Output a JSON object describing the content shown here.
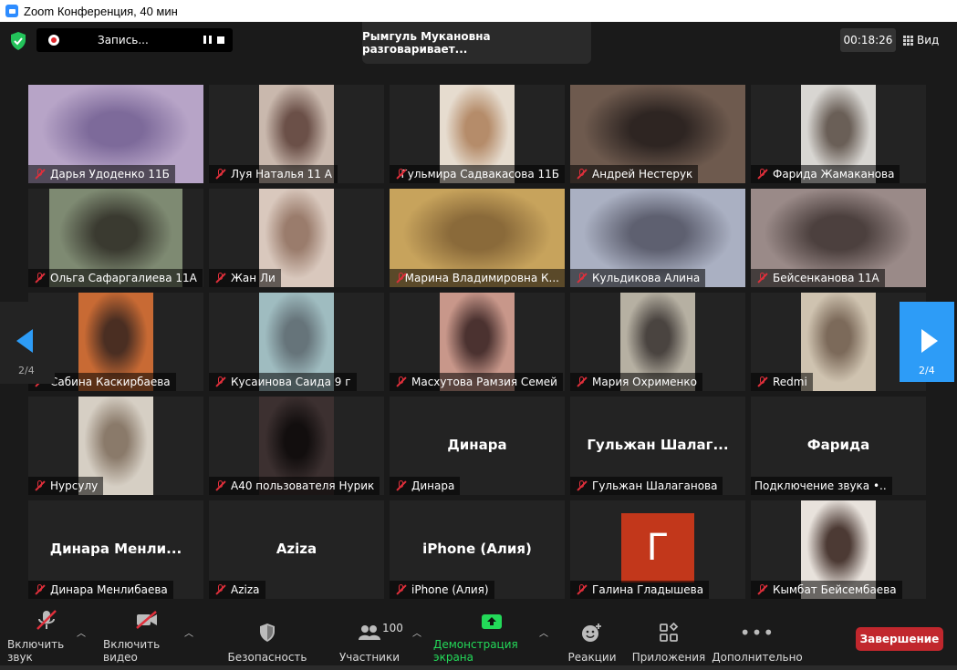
{
  "window": {
    "title": "Zoom Конференция, 40 мин"
  },
  "recording": {
    "label": "Запись..."
  },
  "speaker_banner": "Рымгуль Мукановна разговаривает...",
  "timer": "00:18:26",
  "view_label": "Вид",
  "pagination": {
    "left": "2/4",
    "right": "2/4"
  },
  "participants": [
    {
      "name": "Дарья Удоденко 11Б",
      "muted": true,
      "video": true,
      "vidx": 0,
      "vw": 192,
      "c1": "#b7a4c7",
      "c2": "#7d6a9a"
    },
    {
      "name": "Луя Наталья 11 А",
      "muted": true,
      "video": true,
      "vidx": 55,
      "vw": 82,
      "c1": "#c9b8ad",
      "c2": "#6b5048"
    },
    {
      "name": "Гульмира Садвакасова 11Б",
      "muted": true,
      "video": true,
      "vidx": 55,
      "vw": 82,
      "c1": "#e6dccf",
      "c2": "#b58c6a"
    },
    {
      "name": "Андрей Нестерук",
      "muted": true,
      "video": true,
      "vidx": 0,
      "vw": 192,
      "c1": "#6e5a4e",
      "c2": "#2e2522"
    },
    {
      "name": "Фарида Жамаканова",
      "muted": true,
      "video": true,
      "vidx": 55,
      "vw": 82,
      "c1": "#d8d6d2",
      "c2": "#6a5f57"
    },
    {
      "name": "Ольга Сафаргалиева 11А",
      "muted": true,
      "video": true,
      "vidx": 23,
      "vw": 146,
      "c1": "#7e8a72",
      "c2": "#3a3a30"
    },
    {
      "name": "Жан Ли",
      "muted": true,
      "video": true,
      "vidx": 55,
      "vw": 82,
      "c1": "#d9c8bd",
      "c2": "#9a7c6c"
    },
    {
      "name": "Марина Владимировна К...",
      "muted": true,
      "video": true,
      "vidx": 0,
      "vw": 192,
      "c1": "#c7a35c",
      "c2": "#8a6a3a"
    },
    {
      "name": "Кульдикова Алина",
      "muted": true,
      "video": true,
      "vidx": 0,
      "vw": 192,
      "c1": "#aab0c2",
      "c2": "#5e6070"
    },
    {
      "name": "Бейсенканова 11А",
      "muted": true,
      "video": true,
      "vidx": 0,
      "vw": 192,
      "c1": "#9a8a88",
      "c2": "#4c403e"
    },
    {
      "name": "Сабина Каскирбаева",
      "muted": true,
      "video": true,
      "vidx": 55,
      "vw": 82,
      "c1": "#c86a34",
      "c2": "#4a2e22"
    },
    {
      "name": "Кусаинова Саида 9 г",
      "muted": true,
      "video": true,
      "vidx": 55,
      "vw": 82,
      "c1": "#9fbcc0",
      "c2": "#66747a"
    },
    {
      "name": "Масхутова Рамзия Семей",
      "muted": true,
      "video": true,
      "vidx": 55,
      "vw": 82,
      "c1": "#c8978a",
      "c2": "#4b3230"
    },
    {
      "name": "Мария Охрименко",
      "muted": true,
      "video": true,
      "vidx": 55,
      "vw": 82,
      "c1": "#b6b0a2",
      "c2": "#4a4440"
    },
    {
      "name": "Redmi",
      "muted": true,
      "video": true,
      "vidx": 55,
      "vw": 82,
      "c1": "#cfc3b0",
      "c2": "#7c6a5a"
    },
    {
      "name": "Нурсулу",
      "muted": true,
      "video": true,
      "vidx": 55,
      "vw": 82,
      "c1": "#d6cfc4",
      "c2": "#8a7a6a"
    },
    {
      "name": "А40 пользователя Нурик",
      "muted": true,
      "video": true,
      "vidx": 55,
      "vw": 82,
      "c1": "#3c3030",
      "c2": "#120e0e"
    },
    {
      "name": "Динара",
      "muted": true,
      "video": false,
      "center": "Динара"
    },
    {
      "name": "Гульжан Шалаганова",
      "muted": true,
      "video": false,
      "center": "Гульжан  Шалаг..."
    },
    {
      "name": "Подключение звука •..",
      "muted": false,
      "video": false,
      "center": "Фарида"
    },
    {
      "name": "Динара Менлибаева",
      "muted": true,
      "video": false,
      "center": "Динара  Менли..."
    },
    {
      "name": "Aziza",
      "muted": true,
      "video": false,
      "center": "Aziza"
    },
    {
      "name": "iPhone (Алия)",
      "muted": true,
      "video": false,
      "center": "iPhone (Алия)"
    },
    {
      "name": "Галина Гладышева",
      "muted": true,
      "video": false,
      "avatar": "Г"
    },
    {
      "name": "Кымбат Бейсембаева",
      "muted": true,
      "video": true,
      "vidx": 55,
      "vw": 82,
      "c1": "#e8e2dc",
      "c2": "#4c3a34"
    }
  ],
  "toolbar": {
    "mute": "Включить звук",
    "video": "Включить видео",
    "security": "Безопасность",
    "participants": "Участники",
    "participants_count": "100",
    "share": "Демонстрация экрана",
    "reactions": "Реакции",
    "apps": "Приложения",
    "more": "Дополнительно",
    "end": "Завершение"
  },
  "colors": {
    "accent": "#2d9cf7",
    "muted": "#e02f3b",
    "share": "#23d959",
    "end": "#c1272d"
  }
}
